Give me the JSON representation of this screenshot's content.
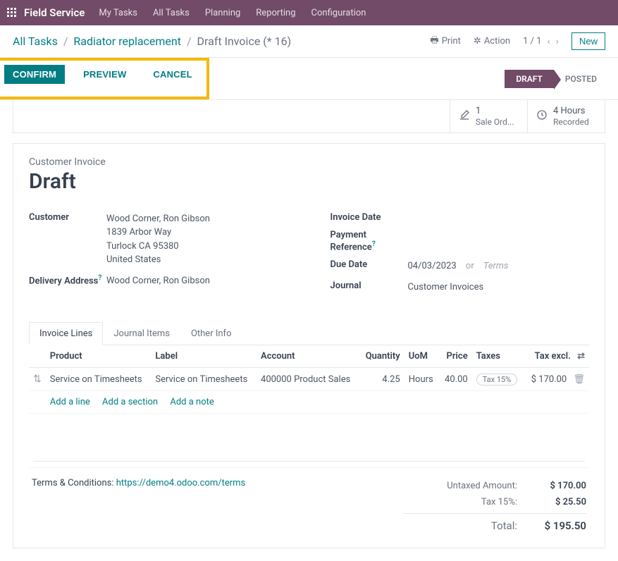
{
  "app_name": "Field Service",
  "nav": [
    "My Tasks",
    "All Tasks",
    "Planning",
    "Reporting",
    "Configuration"
  ],
  "breadcrumb": {
    "items": [
      "All Tasks",
      "Radiator replacement"
    ],
    "current": "Draft Invoice (* 16)"
  },
  "toolbar": {
    "print": "Print",
    "action": "Action",
    "pager": "1 / 1",
    "new": "New"
  },
  "status_actions": {
    "confirm": "CONFIRM",
    "preview": "PREVIEW",
    "cancel": "CANCEL"
  },
  "stages": {
    "draft": "DRAFT",
    "posted": "POSTED"
  },
  "statcards": {
    "sale": {
      "value": "1",
      "label": "Sale Ord..."
    },
    "hours": {
      "value": "4 Hours",
      "label": "Recorded"
    }
  },
  "doc": {
    "type": "Customer Invoice",
    "title": "Draft",
    "customer_label": "Customer",
    "customer_name": "Wood Corner, Ron Gibson",
    "addr1": "1839 Arbor Way",
    "addr2": "Turlock CA 95380",
    "addr3": "United States",
    "delivery_label": "Delivery Address",
    "delivery_value": "Wood Corner, Ron Gibson",
    "invoice_date_label": "Invoice Date",
    "pay_ref_label": "Payment Reference",
    "due_date_label": "Due Date",
    "due_date_value": "04/03/2023",
    "or": "or",
    "terms_placeholder": "Terms",
    "journal_label": "Journal",
    "journal_value": "Customer Invoices"
  },
  "tabs": [
    "Invoice Lines",
    "Journal Items",
    "Other Info"
  ],
  "columns": {
    "product": "Product",
    "label": "Label",
    "account": "Account",
    "qty": "Quantity",
    "uom": "UoM",
    "price": "Price",
    "taxes": "Taxes",
    "taxexcl": "Tax excl."
  },
  "rows": [
    {
      "product": "Service on Timesheets",
      "label": "Service on Timesheets",
      "account": "400000 Product Sales",
      "qty": "4.25",
      "uom": "Hours",
      "price": "40.00",
      "tax": "Tax 15%",
      "taxexcl": "$ 170.00"
    }
  ],
  "line_actions": {
    "add_line": "Add a line",
    "add_section": "Add a section",
    "add_note": "Add a note"
  },
  "terms": {
    "label": "Terms & Conditions: ",
    "url": "https://demo4.odoo.com/terms"
  },
  "totals": {
    "untaxed_label": "Untaxed Amount:",
    "untaxed": "$ 170.00",
    "tax_label": "Tax 15%:",
    "tax": "$ 25.50",
    "total_label": "Total:",
    "total": "$ 195.50"
  }
}
